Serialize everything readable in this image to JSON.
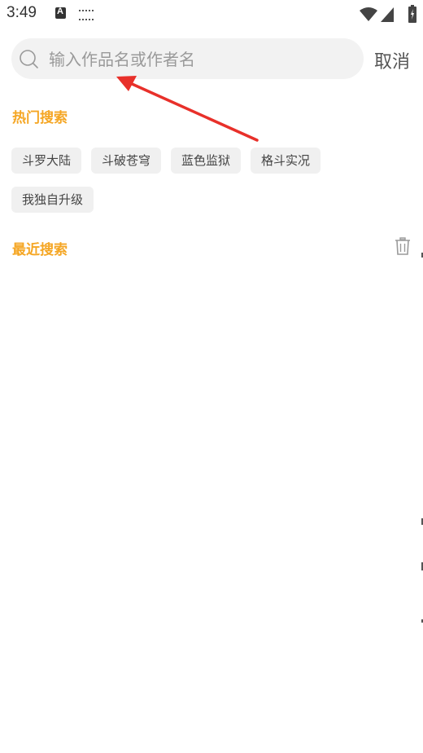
{
  "status_bar": {
    "time": "3:49",
    "icons": [
      "notification-a-icon",
      "keyboard-icon",
      "wifi-icon",
      "signal-icon",
      "battery-icon"
    ]
  },
  "search": {
    "placeholder": "输入作品名或作者名",
    "value": "",
    "cancel_label": "取消"
  },
  "hot_search": {
    "title": "热门搜索",
    "tags": [
      "斗罗大陆",
      "斗破苍穹",
      "蓝色监狱",
      "格斗实况",
      "我独自升级"
    ]
  },
  "recent_search": {
    "title": "最近搜索",
    "clear_icon": "trash-icon"
  },
  "colors": {
    "accent": "#f5a623",
    "annotation_arrow": "#e8302a",
    "tag_background": "#f0f0f0",
    "search_background": "#f2f2f2"
  }
}
